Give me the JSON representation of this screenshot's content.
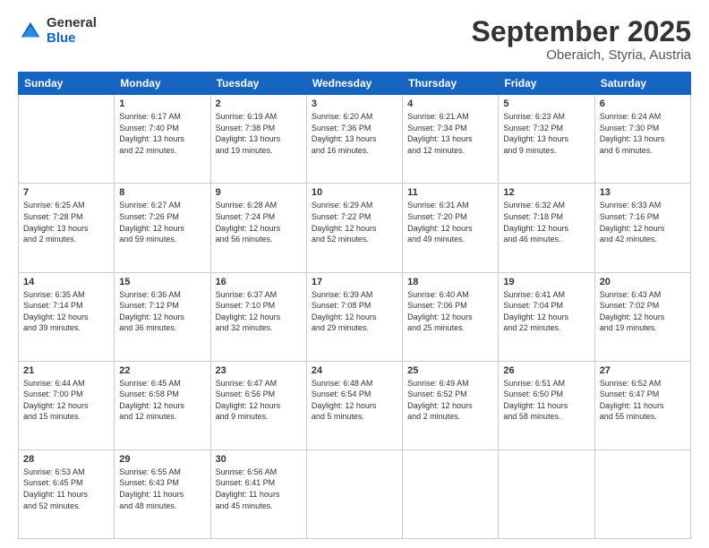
{
  "header": {
    "logo_general": "General",
    "logo_blue": "Blue",
    "month_title": "September 2025",
    "location": "Oberaich, Styria, Austria"
  },
  "days_of_week": [
    "Sunday",
    "Monday",
    "Tuesday",
    "Wednesday",
    "Thursday",
    "Friday",
    "Saturday"
  ],
  "weeks": [
    [
      {
        "day": "",
        "content": ""
      },
      {
        "day": "1",
        "content": "Sunrise: 6:17 AM\nSunset: 7:40 PM\nDaylight: 13 hours\nand 22 minutes."
      },
      {
        "day": "2",
        "content": "Sunrise: 6:19 AM\nSunset: 7:38 PM\nDaylight: 13 hours\nand 19 minutes."
      },
      {
        "day": "3",
        "content": "Sunrise: 6:20 AM\nSunset: 7:36 PM\nDaylight: 13 hours\nand 16 minutes."
      },
      {
        "day": "4",
        "content": "Sunrise: 6:21 AM\nSunset: 7:34 PM\nDaylight: 13 hours\nand 12 minutes."
      },
      {
        "day": "5",
        "content": "Sunrise: 6:23 AM\nSunset: 7:32 PM\nDaylight: 13 hours\nand 9 minutes."
      },
      {
        "day": "6",
        "content": "Sunrise: 6:24 AM\nSunset: 7:30 PM\nDaylight: 13 hours\nand 6 minutes."
      }
    ],
    [
      {
        "day": "7",
        "content": "Sunrise: 6:25 AM\nSunset: 7:28 PM\nDaylight: 13 hours\nand 2 minutes."
      },
      {
        "day": "8",
        "content": "Sunrise: 6:27 AM\nSunset: 7:26 PM\nDaylight: 12 hours\nand 59 minutes."
      },
      {
        "day": "9",
        "content": "Sunrise: 6:28 AM\nSunset: 7:24 PM\nDaylight: 12 hours\nand 56 minutes."
      },
      {
        "day": "10",
        "content": "Sunrise: 6:29 AM\nSunset: 7:22 PM\nDaylight: 12 hours\nand 52 minutes."
      },
      {
        "day": "11",
        "content": "Sunrise: 6:31 AM\nSunset: 7:20 PM\nDaylight: 12 hours\nand 49 minutes."
      },
      {
        "day": "12",
        "content": "Sunrise: 6:32 AM\nSunset: 7:18 PM\nDaylight: 12 hours\nand 46 minutes."
      },
      {
        "day": "13",
        "content": "Sunrise: 6:33 AM\nSunset: 7:16 PM\nDaylight: 12 hours\nand 42 minutes."
      }
    ],
    [
      {
        "day": "14",
        "content": "Sunrise: 6:35 AM\nSunset: 7:14 PM\nDaylight: 12 hours\nand 39 minutes."
      },
      {
        "day": "15",
        "content": "Sunrise: 6:36 AM\nSunset: 7:12 PM\nDaylight: 12 hours\nand 36 minutes."
      },
      {
        "day": "16",
        "content": "Sunrise: 6:37 AM\nSunset: 7:10 PM\nDaylight: 12 hours\nand 32 minutes."
      },
      {
        "day": "17",
        "content": "Sunrise: 6:39 AM\nSunset: 7:08 PM\nDaylight: 12 hours\nand 29 minutes."
      },
      {
        "day": "18",
        "content": "Sunrise: 6:40 AM\nSunset: 7:06 PM\nDaylight: 12 hours\nand 25 minutes."
      },
      {
        "day": "19",
        "content": "Sunrise: 6:41 AM\nSunset: 7:04 PM\nDaylight: 12 hours\nand 22 minutes."
      },
      {
        "day": "20",
        "content": "Sunrise: 6:43 AM\nSunset: 7:02 PM\nDaylight: 12 hours\nand 19 minutes."
      }
    ],
    [
      {
        "day": "21",
        "content": "Sunrise: 6:44 AM\nSunset: 7:00 PM\nDaylight: 12 hours\nand 15 minutes."
      },
      {
        "day": "22",
        "content": "Sunrise: 6:45 AM\nSunset: 6:58 PM\nDaylight: 12 hours\nand 12 minutes."
      },
      {
        "day": "23",
        "content": "Sunrise: 6:47 AM\nSunset: 6:56 PM\nDaylight: 12 hours\nand 9 minutes."
      },
      {
        "day": "24",
        "content": "Sunrise: 6:48 AM\nSunset: 6:54 PM\nDaylight: 12 hours\nand 5 minutes."
      },
      {
        "day": "25",
        "content": "Sunrise: 6:49 AM\nSunset: 6:52 PM\nDaylight: 12 hours\nand 2 minutes."
      },
      {
        "day": "26",
        "content": "Sunrise: 6:51 AM\nSunset: 6:50 PM\nDaylight: 11 hours\nand 58 minutes."
      },
      {
        "day": "27",
        "content": "Sunrise: 6:52 AM\nSunset: 6:47 PM\nDaylight: 11 hours\nand 55 minutes."
      }
    ],
    [
      {
        "day": "28",
        "content": "Sunrise: 6:53 AM\nSunset: 6:45 PM\nDaylight: 11 hours\nand 52 minutes."
      },
      {
        "day": "29",
        "content": "Sunrise: 6:55 AM\nSunset: 6:43 PM\nDaylight: 11 hours\nand 48 minutes."
      },
      {
        "day": "30",
        "content": "Sunrise: 6:56 AM\nSunset: 6:41 PM\nDaylight: 11 hours\nand 45 minutes."
      },
      {
        "day": "",
        "content": ""
      },
      {
        "day": "",
        "content": ""
      },
      {
        "day": "",
        "content": ""
      },
      {
        "day": "",
        "content": ""
      }
    ]
  ]
}
